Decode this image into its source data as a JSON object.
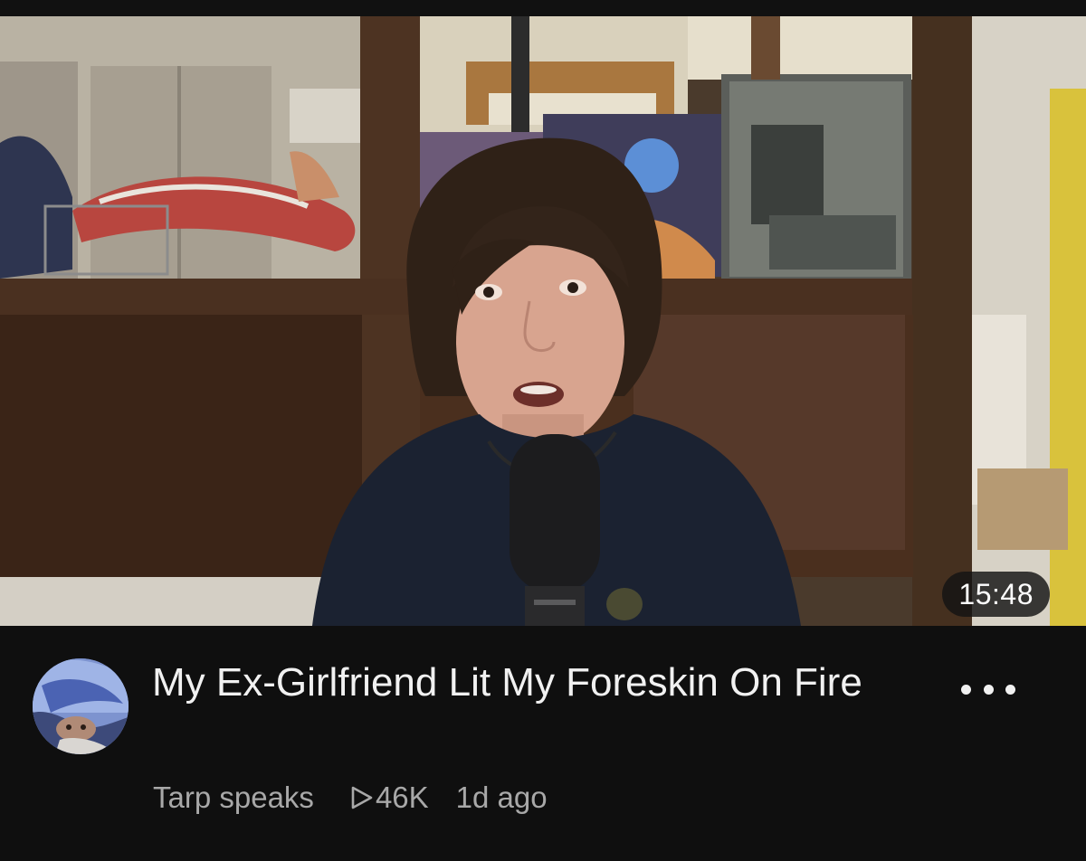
{
  "video": {
    "title": "My Ex-Girlfriend Lit My Foreskin On Fire",
    "duration": "15:48",
    "channel": "Tarp speaks",
    "views": "46K",
    "age": "1d ago"
  },
  "icons": {
    "views": "play-outline-icon",
    "menu": "more-horizontal-icon"
  },
  "colors": {
    "background": "#0f0f0f",
    "title": "#f1f1f1",
    "secondary_text": "#a8a8a8",
    "badge_background": "#141414"
  }
}
